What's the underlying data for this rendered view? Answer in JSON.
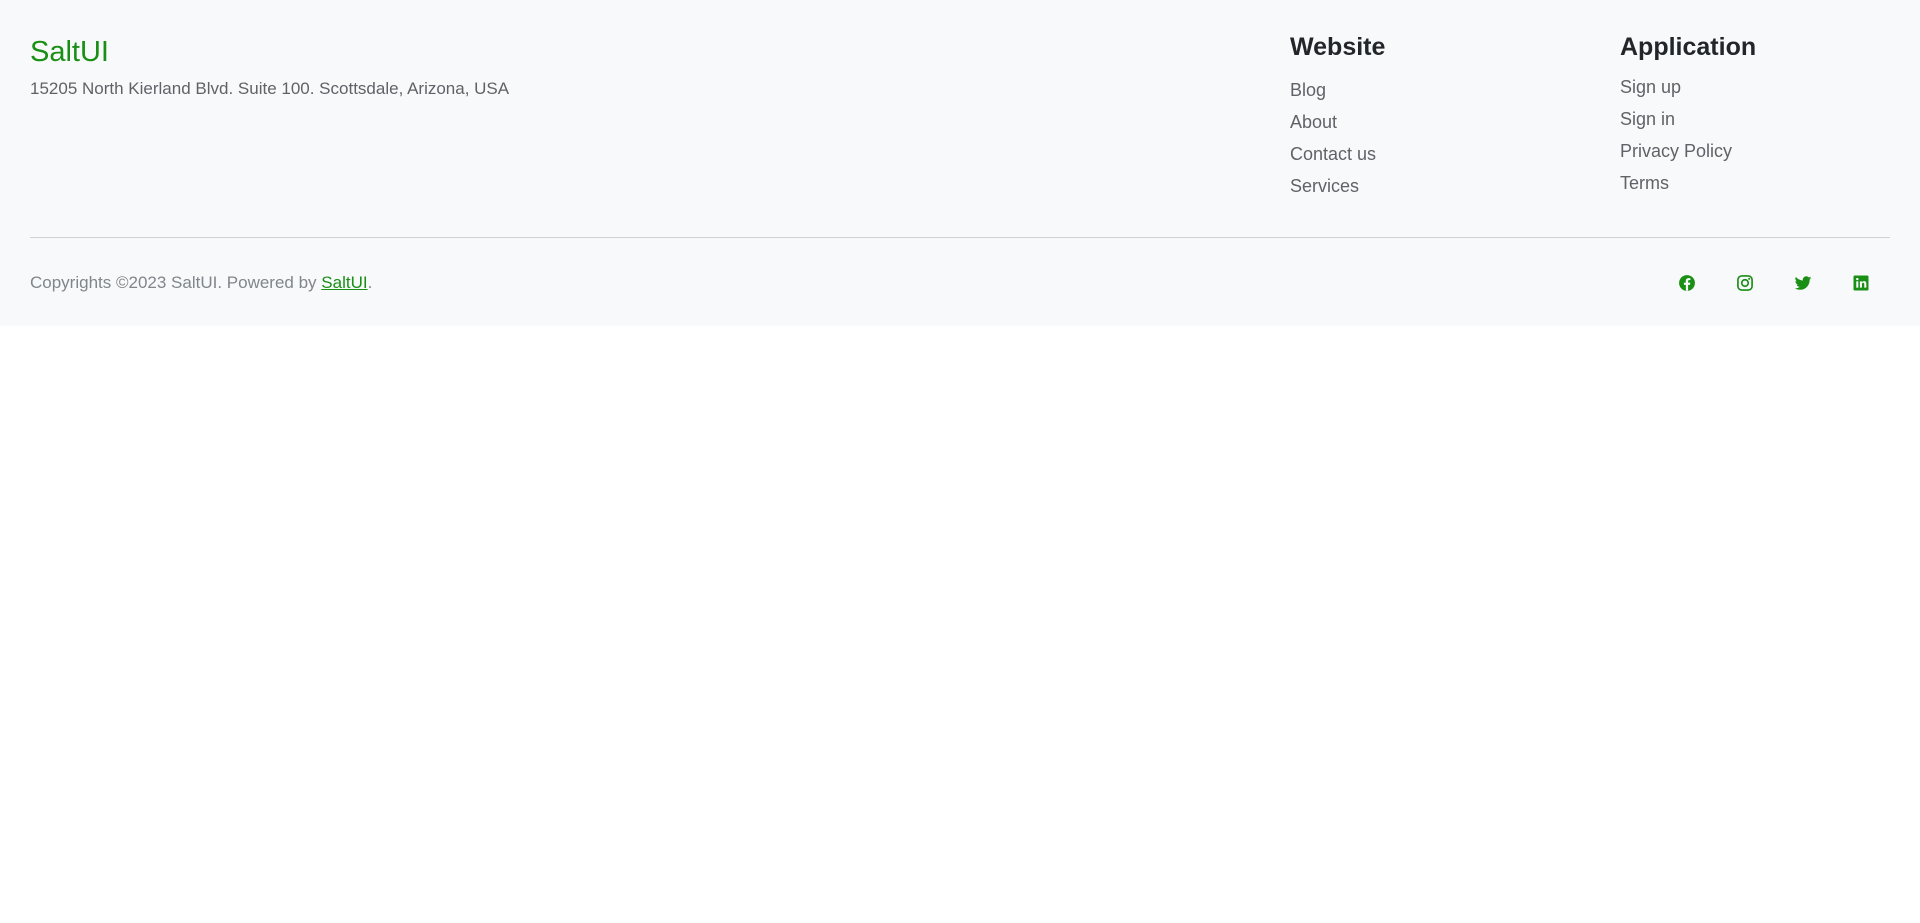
{
  "brand": {
    "name": "SaltUI",
    "address": "15205 North Kierland Blvd. Suite 100. Scottsdale, Arizona, USA"
  },
  "website": {
    "heading": "Website",
    "links": [
      "Blog",
      "About",
      "Contact us",
      "Services"
    ]
  },
  "application": {
    "heading": "Application",
    "links": [
      "Sign up",
      "Sign in",
      "Privacy Policy",
      "Terms"
    ]
  },
  "copyright": {
    "prefix": "Copyrights ©2023 SaltUI. Powered by ",
    "link": "SaltUI",
    "suffix": "."
  },
  "social": {
    "color": "#1a8f16",
    "icons": [
      "facebook-icon",
      "instagram-icon",
      "twitter-icon",
      "linkedin-icon"
    ]
  },
  "colors": {
    "accent": "#1a8f16",
    "footer_background": "#f8f9fa",
    "page_background": "#ffffff"
  }
}
